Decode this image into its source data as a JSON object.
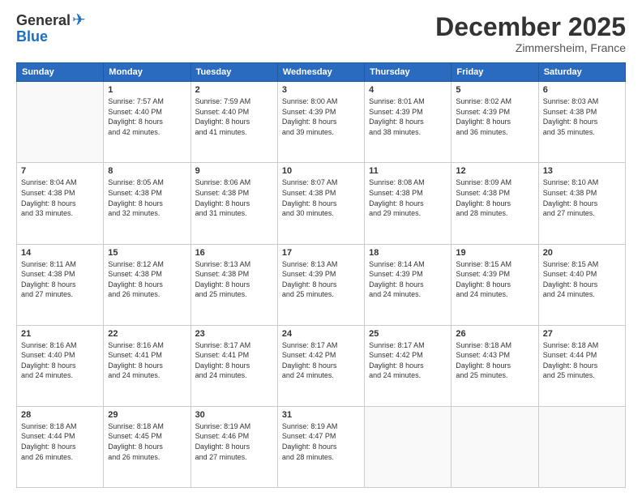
{
  "header": {
    "logo_general": "General",
    "logo_blue": "Blue",
    "month_title": "December 2025",
    "subtitle": "Zimmersheim, France"
  },
  "days_of_week": [
    "Sunday",
    "Monday",
    "Tuesday",
    "Wednesday",
    "Thursday",
    "Friday",
    "Saturday"
  ],
  "weeks": [
    [
      {
        "day": "",
        "info": ""
      },
      {
        "day": "1",
        "info": "Sunrise: 7:57 AM\nSunset: 4:40 PM\nDaylight: 8 hours\nand 42 minutes."
      },
      {
        "day": "2",
        "info": "Sunrise: 7:59 AM\nSunset: 4:40 PM\nDaylight: 8 hours\nand 41 minutes."
      },
      {
        "day": "3",
        "info": "Sunrise: 8:00 AM\nSunset: 4:39 PM\nDaylight: 8 hours\nand 39 minutes."
      },
      {
        "day": "4",
        "info": "Sunrise: 8:01 AM\nSunset: 4:39 PM\nDaylight: 8 hours\nand 38 minutes."
      },
      {
        "day": "5",
        "info": "Sunrise: 8:02 AM\nSunset: 4:39 PM\nDaylight: 8 hours\nand 36 minutes."
      },
      {
        "day": "6",
        "info": "Sunrise: 8:03 AM\nSunset: 4:38 PM\nDaylight: 8 hours\nand 35 minutes."
      }
    ],
    [
      {
        "day": "7",
        "info": "Sunrise: 8:04 AM\nSunset: 4:38 PM\nDaylight: 8 hours\nand 33 minutes."
      },
      {
        "day": "8",
        "info": "Sunrise: 8:05 AM\nSunset: 4:38 PM\nDaylight: 8 hours\nand 32 minutes."
      },
      {
        "day": "9",
        "info": "Sunrise: 8:06 AM\nSunset: 4:38 PM\nDaylight: 8 hours\nand 31 minutes."
      },
      {
        "day": "10",
        "info": "Sunrise: 8:07 AM\nSunset: 4:38 PM\nDaylight: 8 hours\nand 30 minutes."
      },
      {
        "day": "11",
        "info": "Sunrise: 8:08 AM\nSunset: 4:38 PM\nDaylight: 8 hours\nand 29 minutes."
      },
      {
        "day": "12",
        "info": "Sunrise: 8:09 AM\nSunset: 4:38 PM\nDaylight: 8 hours\nand 28 minutes."
      },
      {
        "day": "13",
        "info": "Sunrise: 8:10 AM\nSunset: 4:38 PM\nDaylight: 8 hours\nand 27 minutes."
      }
    ],
    [
      {
        "day": "14",
        "info": "Sunrise: 8:11 AM\nSunset: 4:38 PM\nDaylight: 8 hours\nand 27 minutes."
      },
      {
        "day": "15",
        "info": "Sunrise: 8:12 AM\nSunset: 4:38 PM\nDaylight: 8 hours\nand 26 minutes."
      },
      {
        "day": "16",
        "info": "Sunrise: 8:13 AM\nSunset: 4:38 PM\nDaylight: 8 hours\nand 25 minutes."
      },
      {
        "day": "17",
        "info": "Sunrise: 8:13 AM\nSunset: 4:39 PM\nDaylight: 8 hours\nand 25 minutes."
      },
      {
        "day": "18",
        "info": "Sunrise: 8:14 AM\nSunset: 4:39 PM\nDaylight: 8 hours\nand 24 minutes."
      },
      {
        "day": "19",
        "info": "Sunrise: 8:15 AM\nSunset: 4:39 PM\nDaylight: 8 hours\nand 24 minutes."
      },
      {
        "day": "20",
        "info": "Sunrise: 8:15 AM\nSunset: 4:40 PM\nDaylight: 8 hours\nand 24 minutes."
      }
    ],
    [
      {
        "day": "21",
        "info": "Sunrise: 8:16 AM\nSunset: 4:40 PM\nDaylight: 8 hours\nand 24 minutes."
      },
      {
        "day": "22",
        "info": "Sunrise: 8:16 AM\nSunset: 4:41 PM\nDaylight: 8 hours\nand 24 minutes."
      },
      {
        "day": "23",
        "info": "Sunrise: 8:17 AM\nSunset: 4:41 PM\nDaylight: 8 hours\nand 24 minutes."
      },
      {
        "day": "24",
        "info": "Sunrise: 8:17 AM\nSunset: 4:42 PM\nDaylight: 8 hours\nand 24 minutes."
      },
      {
        "day": "25",
        "info": "Sunrise: 8:17 AM\nSunset: 4:42 PM\nDaylight: 8 hours\nand 24 minutes."
      },
      {
        "day": "26",
        "info": "Sunrise: 8:18 AM\nSunset: 4:43 PM\nDaylight: 8 hours\nand 25 minutes."
      },
      {
        "day": "27",
        "info": "Sunrise: 8:18 AM\nSunset: 4:44 PM\nDaylight: 8 hours\nand 25 minutes."
      }
    ],
    [
      {
        "day": "28",
        "info": "Sunrise: 8:18 AM\nSunset: 4:44 PM\nDaylight: 8 hours\nand 26 minutes."
      },
      {
        "day": "29",
        "info": "Sunrise: 8:18 AM\nSunset: 4:45 PM\nDaylight: 8 hours\nand 26 minutes."
      },
      {
        "day": "30",
        "info": "Sunrise: 8:19 AM\nSunset: 4:46 PM\nDaylight: 8 hours\nand 27 minutes."
      },
      {
        "day": "31",
        "info": "Sunrise: 8:19 AM\nSunset: 4:47 PM\nDaylight: 8 hours\nand 28 minutes."
      },
      {
        "day": "",
        "info": ""
      },
      {
        "day": "",
        "info": ""
      },
      {
        "day": "",
        "info": ""
      }
    ]
  ]
}
